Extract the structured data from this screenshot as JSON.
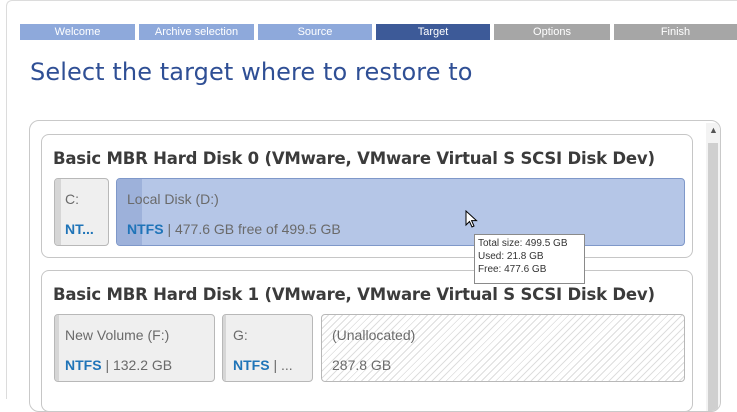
{
  "steps": [
    {
      "label": "Welcome",
      "state": "done"
    },
    {
      "label": "Archive selection",
      "state": "done"
    },
    {
      "label": "Source",
      "state": "done"
    },
    {
      "label": "Target",
      "state": "current"
    },
    {
      "label": "Options",
      "state": "todo"
    },
    {
      "label": "Finish",
      "state": "todo"
    }
  ],
  "page_title": "Select the target where to restore to",
  "disks": [
    {
      "title": "Basic MBR Hard Disk 0 (VMware, VMware Virtual S SCSI Disk Dev)",
      "partitions": [
        {
          "name": "C:",
          "fs": "NT...",
          "info": ""
        },
        {
          "name": "Local Disk (D:)",
          "fs": "NTFS",
          "info": " | 477.6 GB free of 499.5 GB"
        }
      ]
    },
    {
      "title": "Basic MBR Hard Disk 1 (VMware, VMware Virtual S SCSI Disk Dev)",
      "partitions": [
        {
          "name": "New Volume (F:)",
          "fs": "NTFS",
          "info": " | 132.2 GB"
        },
        {
          "name": "G:",
          "fs": "NTFS",
          "info": " | ..."
        },
        {
          "name": "(Unallocated)",
          "fs": "",
          "info": "287.8 GB"
        }
      ]
    }
  ],
  "tooltip": {
    "total": "Total size: 499.5 GB",
    "used": "Used: 21.8 GB",
    "free": "Free: 477.6 GB"
  },
  "scrollbar": {
    "up_icon": "chevron-up-icon"
  },
  "colors": {
    "step_done": "#8ea9db",
    "step_current": "#3d5a98",
    "step_todo": "#a6a6a6",
    "title": "#2f4f95",
    "fs": "#1f74b8"
  }
}
